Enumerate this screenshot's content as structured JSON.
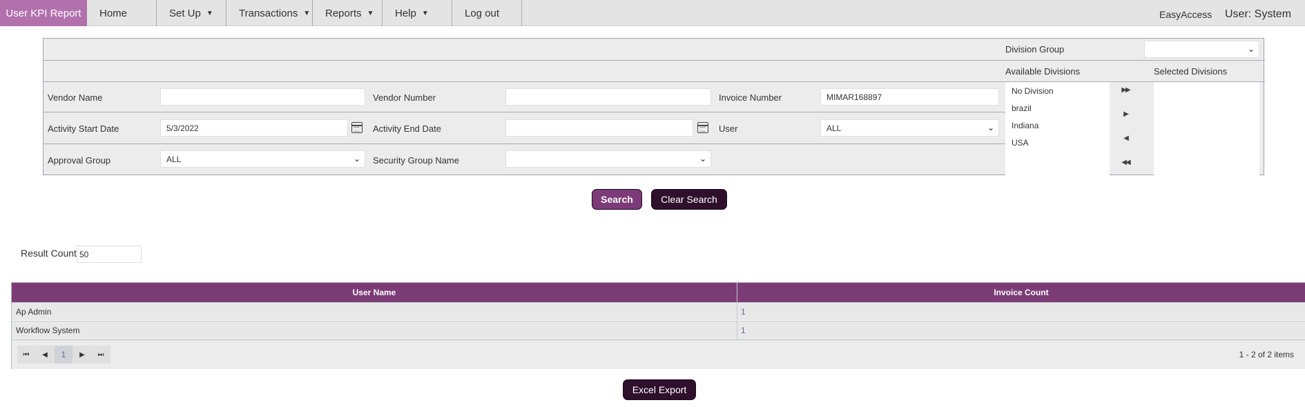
{
  "nav": {
    "brand": "User KPI Report",
    "items": [
      {
        "label": "Home",
        "caret": ""
      },
      {
        "label": "Set Up",
        "caret": "▼"
      },
      {
        "label": "Transactions",
        "caret": "▼"
      },
      {
        "label": "Reports",
        "caret": "▼"
      },
      {
        "label": "Help",
        "caret": "▼"
      },
      {
        "label": "Log out",
        "caret": ""
      }
    ],
    "app_name": "EasyAccess",
    "user": "User: System"
  },
  "filters": {
    "division_group_label": "Division Group",
    "division_group_value": "",
    "available_divisions_label": "Available Divisions",
    "selected_divisions_label": "Selected Divisions",
    "available_divisions": [
      "No Division",
      "brazil",
      "Indiana",
      "USA"
    ],
    "selected_divisions": [],
    "move_buttons": {
      "all_right": "▶▶",
      "right": "▶",
      "left": "◀",
      "all_left": "◀◀"
    },
    "vendor_name_label": "Vendor Name",
    "vendor_name_value": "",
    "vendor_number_label": "Vendor Number",
    "vendor_number_value": "",
    "invoice_number_label": "Invoice Number",
    "invoice_number_value": "MIMAR168897",
    "activity_start_label": "Activity Start Date",
    "activity_start_value": "5/3/2022",
    "activity_end_label": "Activity End Date",
    "activity_end_value": "",
    "user_label": "User",
    "user_value": "ALL",
    "approval_group_label": "Approval Group",
    "approval_group_value": "ALL",
    "security_group_label": "Security Group Name",
    "security_group_value": ""
  },
  "actions": {
    "search": "Search",
    "clear_search": "Clear Search",
    "excel_export": "Excel Export"
  },
  "result_count": {
    "label": "Result Count",
    "value": "50"
  },
  "grid": {
    "columns": [
      "User Name",
      "Invoice Count"
    ],
    "rows": [
      {
        "user_name": "Ap Admin",
        "invoice_count": "1"
      },
      {
        "user_name": "Workflow System",
        "invoice_count": "1"
      }
    ],
    "pager": {
      "first": "⏮",
      "prev": "◀",
      "current_page": "1",
      "next": "▶",
      "last": "⏭",
      "info": "1 - 2 of 2 items"
    }
  }
}
